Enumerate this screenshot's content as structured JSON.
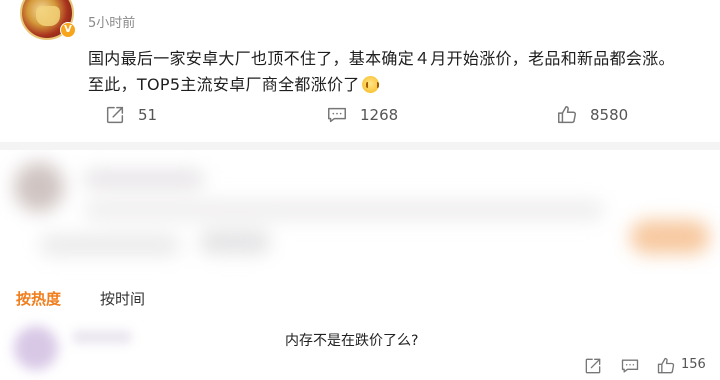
{
  "post": {
    "username": "",
    "time": "5小时前",
    "badge": "V",
    "text_line1": "国内最后一家安卓大厂也顶不住了，基本确定４月开始涨价，老品和新品都会涨。",
    "text_line2": "至此，TOP5主流安卓厂商全都涨价了",
    "emoji_icon": "grimace-emoji-icon",
    "actions": {
      "share_count": "51",
      "comment_count": "1268",
      "like_count": "8580"
    }
  },
  "sort": {
    "hot_label": "按热度",
    "time_label": "按时间"
  },
  "comment": {
    "text": "内存不是在跌价了么?",
    "like_count": "156"
  },
  "colors": {
    "accent": "#f07e1d",
    "text": "#222222",
    "muted": "#8a8a8a",
    "icon": "#555555"
  },
  "icons": [
    "share-icon",
    "comment-icon",
    "like-icon",
    "verified-badge-icon"
  ]
}
